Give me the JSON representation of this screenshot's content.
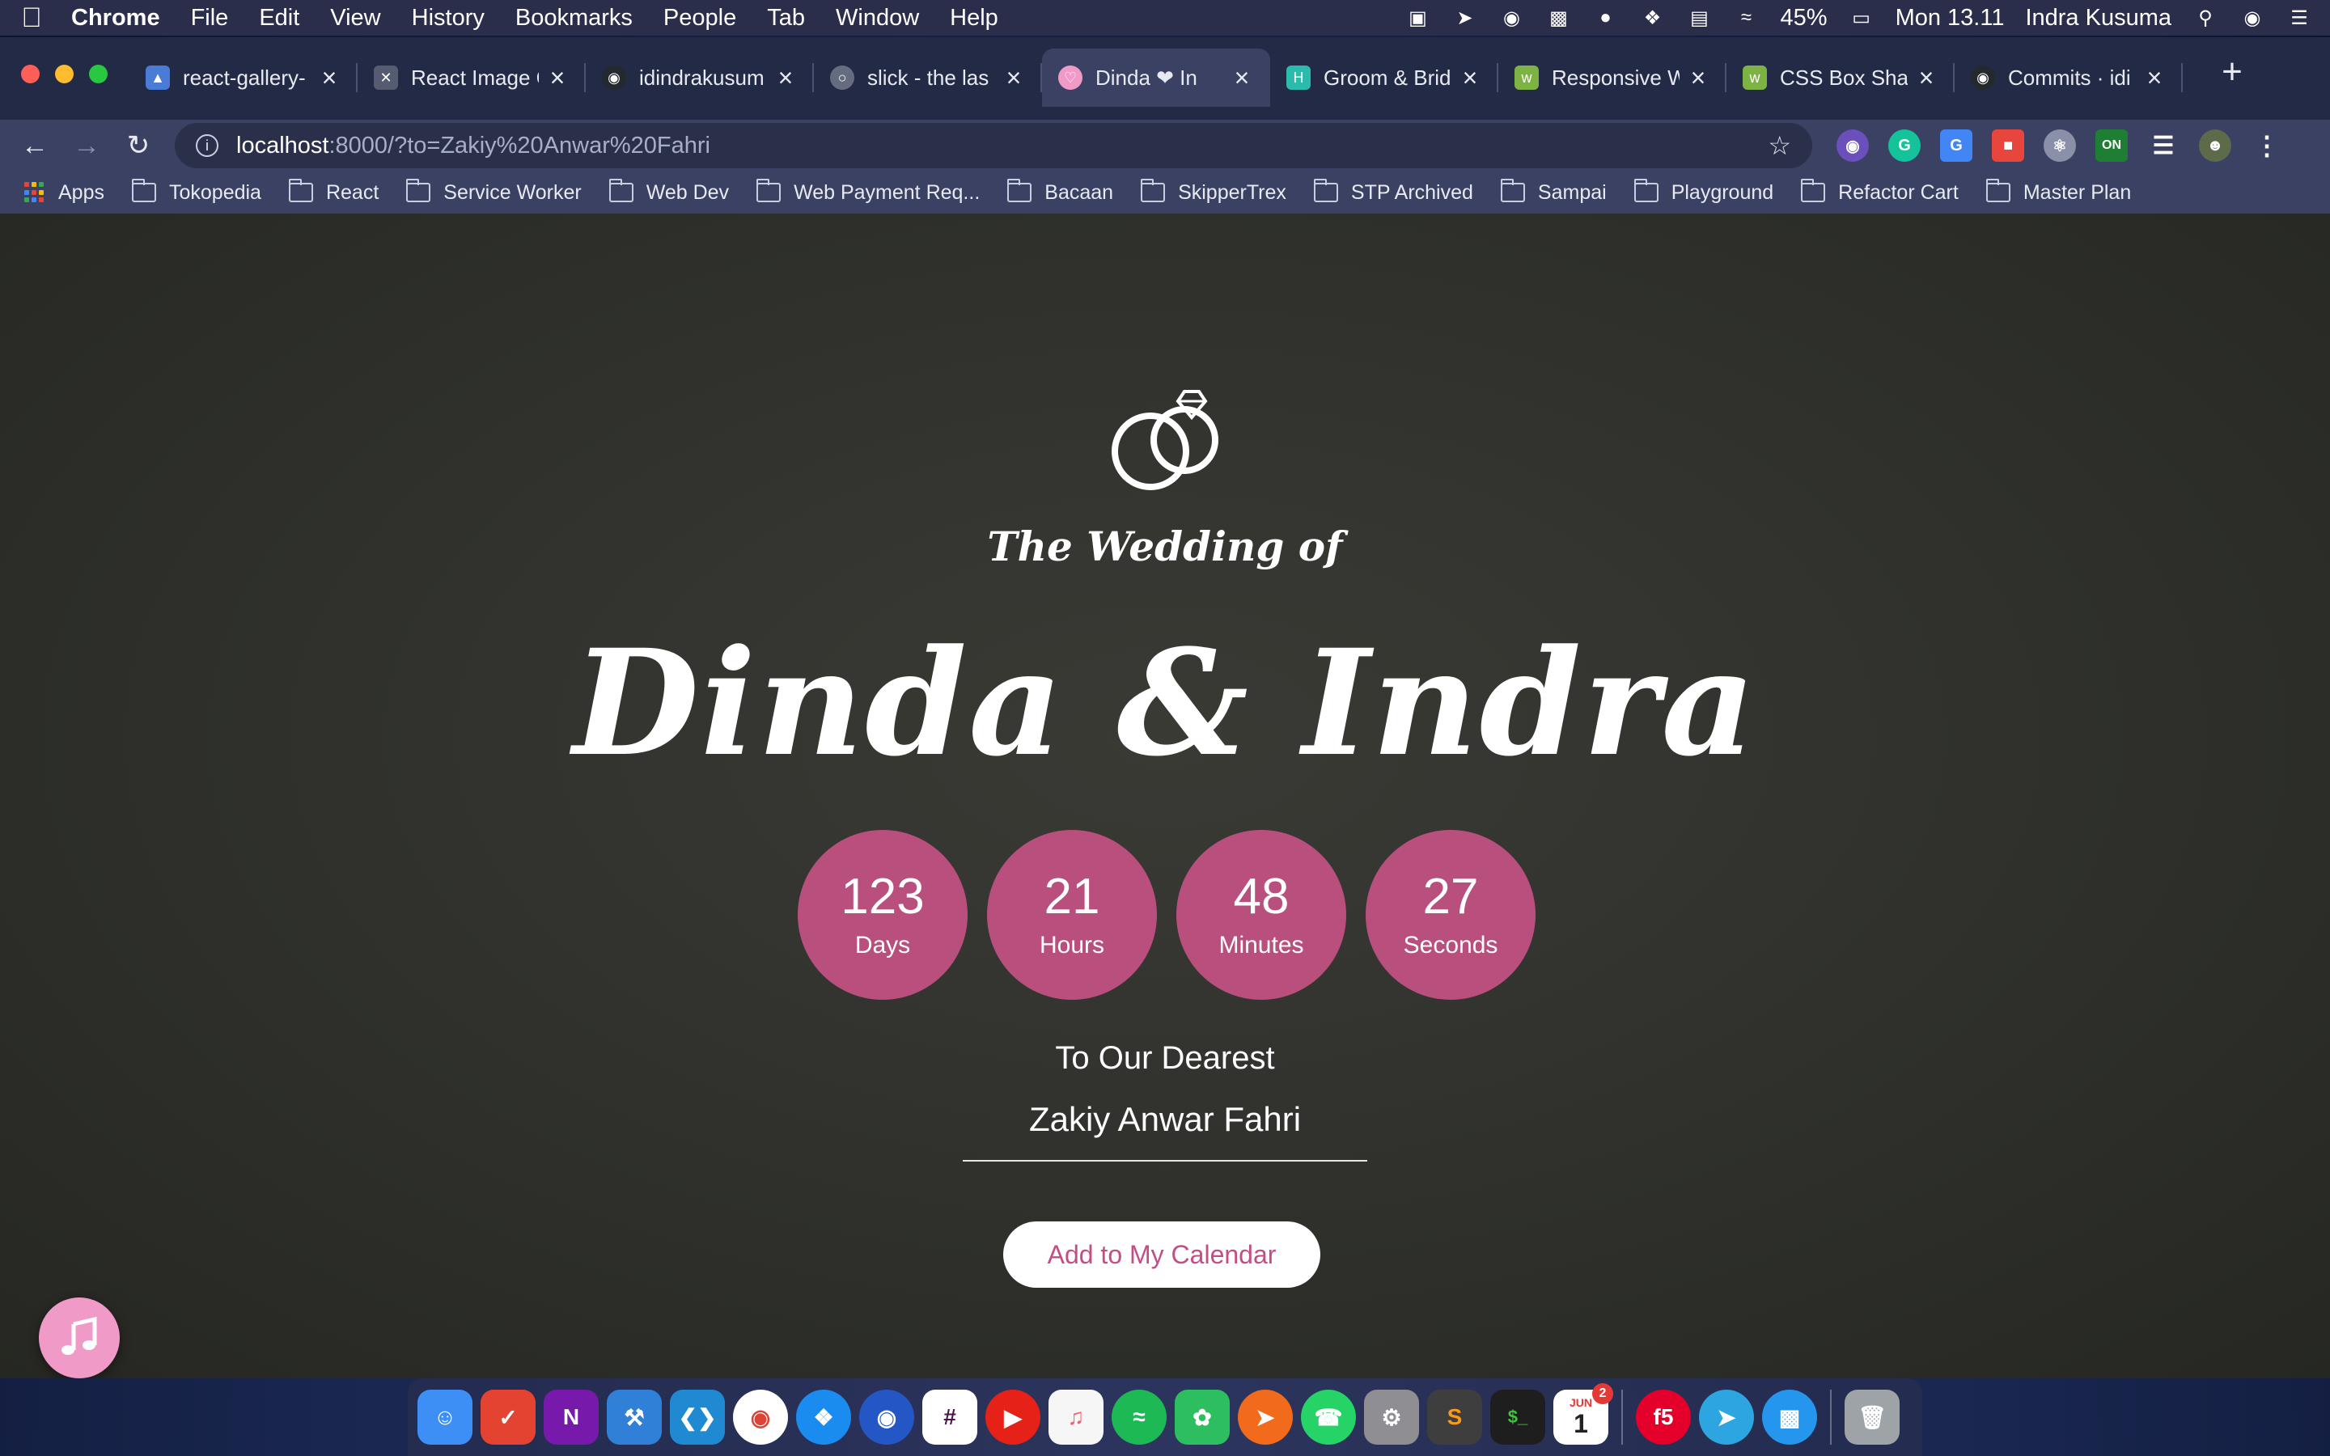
{
  "menubar": {
    "app_name": "Chrome",
    "menus": [
      "File",
      "Edit",
      "View",
      "History",
      "Bookmarks",
      "People",
      "Tab",
      "Window",
      "Help"
    ],
    "battery": "45%",
    "clock": "Mon 13.11",
    "user": "Indra Kusuma"
  },
  "tabs": [
    {
      "title": "react-gallery-",
      "favicon_color": "#4a7bd6"
    },
    {
      "title": "React Image G",
      "favicon_color": "#555b70"
    },
    {
      "title": "idindrakusum",
      "favicon_color": "#24292e"
    },
    {
      "title": "slick - the las",
      "favicon_color": "#666c80"
    },
    {
      "title": "Dinda ❤ In",
      "favicon_color": "#f09ac8",
      "active": true
    },
    {
      "title": "Groom & Brid",
      "favicon_color": "#2bbbad"
    },
    {
      "title": "Responsive W",
      "favicon_color": "#7cb342"
    },
    {
      "title": "CSS Box Shad",
      "favicon_color": "#7cb342"
    },
    {
      "title": "Commits · idi",
      "favicon_color": "#24292e"
    }
  ],
  "omnibox": {
    "host": "localhost",
    "path": ":8000/?to=Zakiy%20Anwar%20Fahri"
  },
  "bookmarks": {
    "apps_label": "Apps",
    "folders": [
      "Tokopedia",
      "React",
      "Service Worker",
      "Web Dev",
      "Web Payment Req...",
      "Bacaan",
      "SkipperTrex",
      "STP Archived",
      "Sampai",
      "Playground",
      "Refactor Cart",
      "Master Plan"
    ]
  },
  "page": {
    "subtitle": "The Wedding of",
    "couple": "Dinda & Indra",
    "countdown": [
      {
        "value": "123",
        "unit": "Days"
      },
      {
        "value": "21",
        "unit": "Hours"
      },
      {
        "value": "48",
        "unit": "Minutes"
      },
      {
        "value": "27",
        "unit": "Seconds"
      }
    ],
    "dearest_label": "To Our Dearest",
    "guest_name": "Zakiy Anwar Fahri",
    "calendar_button": "Add to My Calendar",
    "accent_color": "#b94f7d"
  },
  "dock": {
    "calendar_month": "JUN",
    "calendar_day": "1",
    "calendar_badge": "2"
  }
}
